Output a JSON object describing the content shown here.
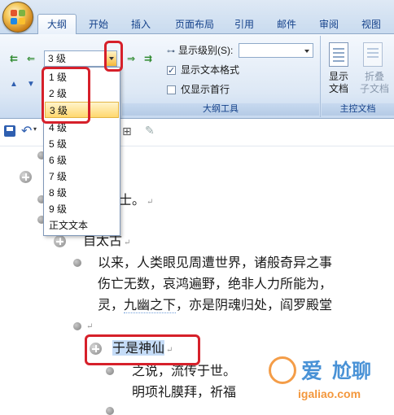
{
  "ribbon": {
    "tabs": [
      {
        "label": "大纲",
        "active": true
      },
      {
        "label": "开始",
        "active": false
      },
      {
        "label": "插入",
        "active": false
      },
      {
        "label": "页面布局",
        "active": false
      },
      {
        "label": "引用",
        "active": false
      },
      {
        "label": "邮件",
        "active": false
      },
      {
        "label": "审阅",
        "active": false
      },
      {
        "label": "视图",
        "active": false
      }
    ],
    "outline_tools": {
      "level_combo_value": "3 级",
      "show_level_label": "显示级别(S):",
      "show_text_format_label": "显示文本格式",
      "show_text_format_checked": true,
      "first_line_only_label": "仅显示首行",
      "first_line_only_checked": false,
      "group_label": "大纲工具"
    },
    "master_document": {
      "show_document_label": "显示\n文档",
      "collapse_label": "折叠\n子文档",
      "group_label": "主控文档"
    }
  },
  "level_dropdown": {
    "items": [
      "1 级",
      "2 级",
      "3 级",
      "4 级",
      "5 级",
      "6 级",
      "7 级",
      "8 级",
      "9 级",
      "正文文本"
    ],
    "highlighted": "3 级"
  },
  "document": {
    "lines": {
      "l1": "士。",
      "l2": "自太古",
      "l3": "以来，人类眼见周遭世界，诸般奇异之事",
      "l4": "伤亡无数，哀鸿遍野，绝非人力所能为，",
      "l5a": "灵，",
      "l5b": "九幽之下",
      "l5c": "，亦是阴魂归处，阎罗殿堂",
      "l6": "于是神仙",
      "l7a": "之说，流传于世",
      "l7b": "。",
      "l8": "明项礼膜拜，祈福"
    }
  },
  "watermark": {
    "line1": "爱",
    "line2": "尬聊",
    "line3": "igaliao.com"
  },
  "colors": {
    "highlight_red": "#d6202a",
    "ribbon_text": "#15428b",
    "selection": "#c5dcf7"
  }
}
